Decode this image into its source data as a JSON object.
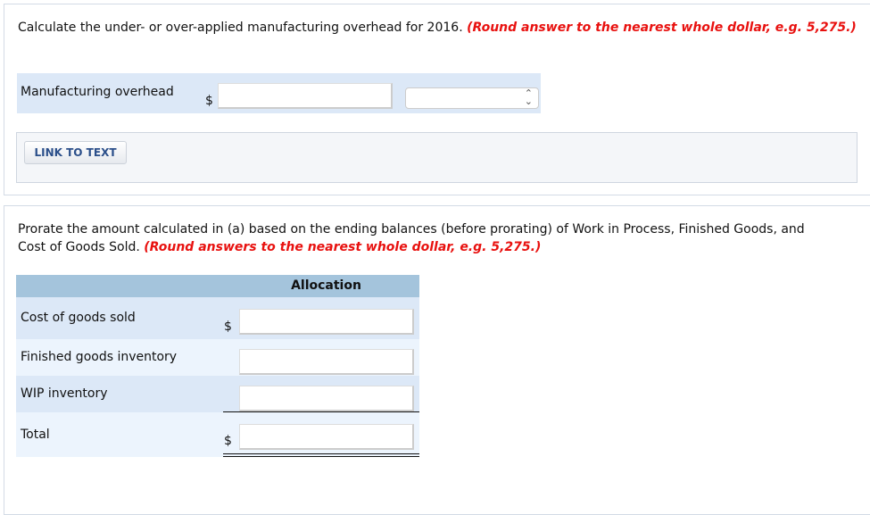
{
  "part_a": {
    "instruction": "Calculate the under- or over-applied manufacturing overhead for 2016.",
    "note": "(Round answer to the nearest whole dollar, e.g. 5,275.)",
    "row_label": "Manufacturing overhead",
    "currency": "$",
    "amount_value": "",
    "select_value": "",
    "link_button": "LINK TO TEXT"
  },
  "part_b": {
    "instruction": "Prorate the amount calculated in (a) based on the ending balances (before prorating) of Work in Process, Finished Goods, and Cost of Goods Sold.",
    "note": "(Round answers to the nearest whole dollar, e.g. 5,275.)",
    "column_header": "Allocation",
    "rows": [
      {
        "label": "Cost of goods sold",
        "currency": "$",
        "value": ""
      },
      {
        "label": "Finished goods inventory",
        "currency": "",
        "value": ""
      },
      {
        "label": "WIP inventory",
        "currency": "",
        "value": ""
      },
      {
        "label": "Total",
        "currency": "$",
        "value": ""
      }
    ]
  },
  "colors": {
    "note_red": "#e8110f",
    "row_bg": "#dce8f7",
    "header_bg": "#a4c4dc",
    "button_text": "#2b4f8a"
  }
}
